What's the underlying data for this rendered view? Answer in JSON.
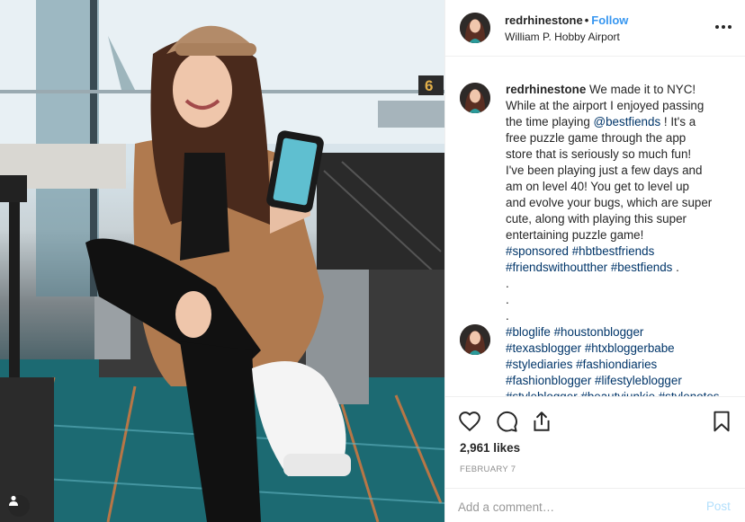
{
  "post": {
    "username": "redrhinestone",
    "follow_label": "Follow",
    "separator": "•",
    "location": "William P. Hobby Airport",
    "gate_number": "6"
  },
  "caption": {
    "username": "redrhinestone",
    "line1": "We made it to NYC!",
    "line2": "While at the airport I enjoyed passing",
    "line3a": "the time playing ",
    "mention": "@bestfiends",
    "line3b": " ! It's a",
    "line4": "free puzzle game through the app",
    "line5": "store that is seriously so much fun!",
    "line6": "I've been playing just a few days and",
    "line7": "am on level 40! You get to level up",
    "line8": "and evolve your bugs, which are super",
    "line9": "cute, along with playing this super",
    "line10": "entertaining puzzle game!",
    "hashtags1": "#sponsored #hbtbestfriends"
  },
  "comment": {
    "hashtags_a": "#friendswithoutther #bestfiends",
    "trailing": " .",
    "dot1": ".",
    "dot2": ".",
    "dot3": ".",
    "tags1": "#bloglife #houstonblogger",
    "tags2": "#texasblogger #htxbloggerbabe",
    "tags3": "#stylediaries #fashiondiaries",
    "tags4": "#fashionblogger #lifestyleblogger",
    "tags5": "#styleblogger #beautyjunkie #stylenotes"
  },
  "actions": {
    "likes": "2,961 likes",
    "date": "FEBRUARY 7",
    "comment_placeholder": "Add a comment…",
    "post_label": "Post"
  },
  "icons": [
    "heart-icon",
    "comment-icon",
    "share-icon",
    "bookmark-icon",
    "more-options-icon",
    "user-tag-icon"
  ],
  "colors": {
    "link": "#3897f0",
    "hashtag": "#003569",
    "muted": "#8e8e8e",
    "post_disabled": "#b2dffc",
    "border": "#efefef"
  }
}
